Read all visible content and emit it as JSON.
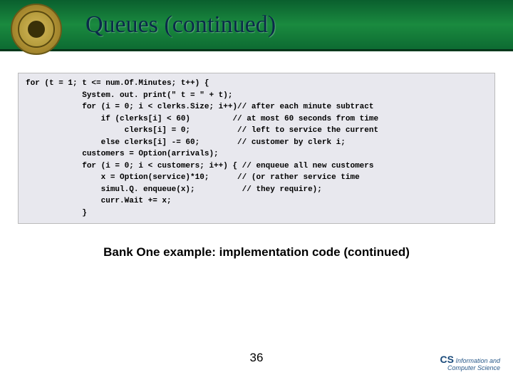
{
  "header": {
    "title": "Queues (continued)"
  },
  "code": {
    "lines": [
      "for (t = 1; t <= num.Of.Minutes; t++) {",
      "            System. out. print(\" t = \" + t);",
      "            for (i = 0; i < clerks.Size; i++)// after each minute subtract",
      "                if (clerks[i] < 60)         // at most 60 seconds from time",
      "                     clerks[i] = 0;          // left to service the current",
      "                else clerks[i] -= 60;        // customer by clerk i;",
      "            customers = Option(arrivals);",
      "            for (i = 0; i < customers; i++) { // enqueue all new customers",
      "                x = Option(service)*10;      // (or rather service time",
      "                simul.Q. enqueue(x);          // they require);",
      "                curr.Wait += x;",
      "            }"
    ]
  },
  "caption": "Bank One example: implementation code (continued)",
  "page_number": "36",
  "footer": {
    "line1": "Information and",
    "line2": "Computer Science",
    "badge": "CS"
  }
}
